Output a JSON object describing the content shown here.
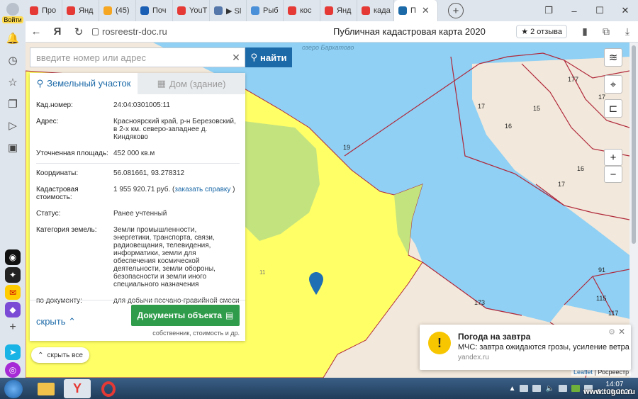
{
  "browser": {
    "tabs": [
      {
        "label": "Про",
        "color": "#e53935"
      },
      {
        "label": "Янд",
        "color": "#e53935"
      },
      {
        "label": "(45)",
        "color": "#f5a623"
      },
      {
        "label": "Поч",
        "color": "#1a5fb4"
      },
      {
        "label": "YouT",
        "color": "#e53935"
      },
      {
        "label": "▶ Sl",
        "color": "#5577aa"
      },
      {
        "label": "Рыб",
        "color": "#4a90d9"
      },
      {
        "label": "кос",
        "color": "#e53935"
      },
      {
        "label": "Янд",
        "color": "#e53935"
      },
      {
        "label": "када",
        "color": "#e53935"
      },
      {
        "label": "П",
        "color": "#1d6aa8",
        "active": true
      }
    ],
    "sidebar_login": "Войти",
    "url": "rosreestr-doc.ru",
    "page_title": "Публичная кадастровая карта 2020",
    "reviews": "2 отзыва"
  },
  "search": {
    "placeholder": "введите номер или адрес",
    "button_label": "найти"
  },
  "panel": {
    "tab_land": "Земельный участок",
    "tab_house": "Дом (здание)",
    "rows": [
      {
        "k": "Кад.номер:",
        "v": "24:04:0301005:11"
      },
      {
        "k": "Адрес:",
        "v": "Красноярский край, р-н Березовский, в 2-х км. северо-западнее д. Киндяково"
      },
      {
        "k": "Уточненная площадь:",
        "v": "452 000 кв.м"
      },
      {
        "k": "Координаты:",
        "v": "56.081661, 93.278312"
      },
      {
        "k": "Кадастровая стоимость:",
        "v": "1 955 920.71 руб. (",
        "link": "заказать справку",
        "after": " )"
      },
      {
        "k": "Статус:",
        "v": "Ранее учтенный"
      },
      {
        "k": "Категория земель:",
        "v": "Земли промышленности, энергетики, транспорта, связи, радиовещания, телевидения, информатики, земли для обеспечения космической деятельности, земли обороны, безопасности и земли иного специального назначения"
      },
      {
        "k": "по документу:",
        "v": "для добычи песчано-гравийной смеси"
      }
    ],
    "hide_label": "скрыть",
    "docs_button": "Документы объекта",
    "docs_sub": "собственник, стоимость и др."
  },
  "hide_all": "скрыть все",
  "map": {
    "lake_label": "озеро Бархатово",
    "parcel_labels": [
      "19",
      "17",
      "15",
      "16",
      "16",
      "17",
      "177",
      "17",
      "91",
      "173",
      "115",
      "117",
      "11"
    ],
    "attribution_1": "Leaflet",
    "attribution_2": "Росреестр",
    "colors": {
      "water": "#8fd0f4",
      "parcel": "#ffff66",
      "green": "#c3e37f",
      "land": "#f2e8db",
      "border": "#b0283a"
    }
  },
  "notification": {
    "title": "Погода на завтра",
    "text": "МЧС: завтра ожидаются грозы, усиление ветра",
    "source": "yandex.ru"
  },
  "taskbar": {
    "time": "14:07",
    "date": "01.09.2020",
    "watermark": "www.tugun.ru"
  }
}
